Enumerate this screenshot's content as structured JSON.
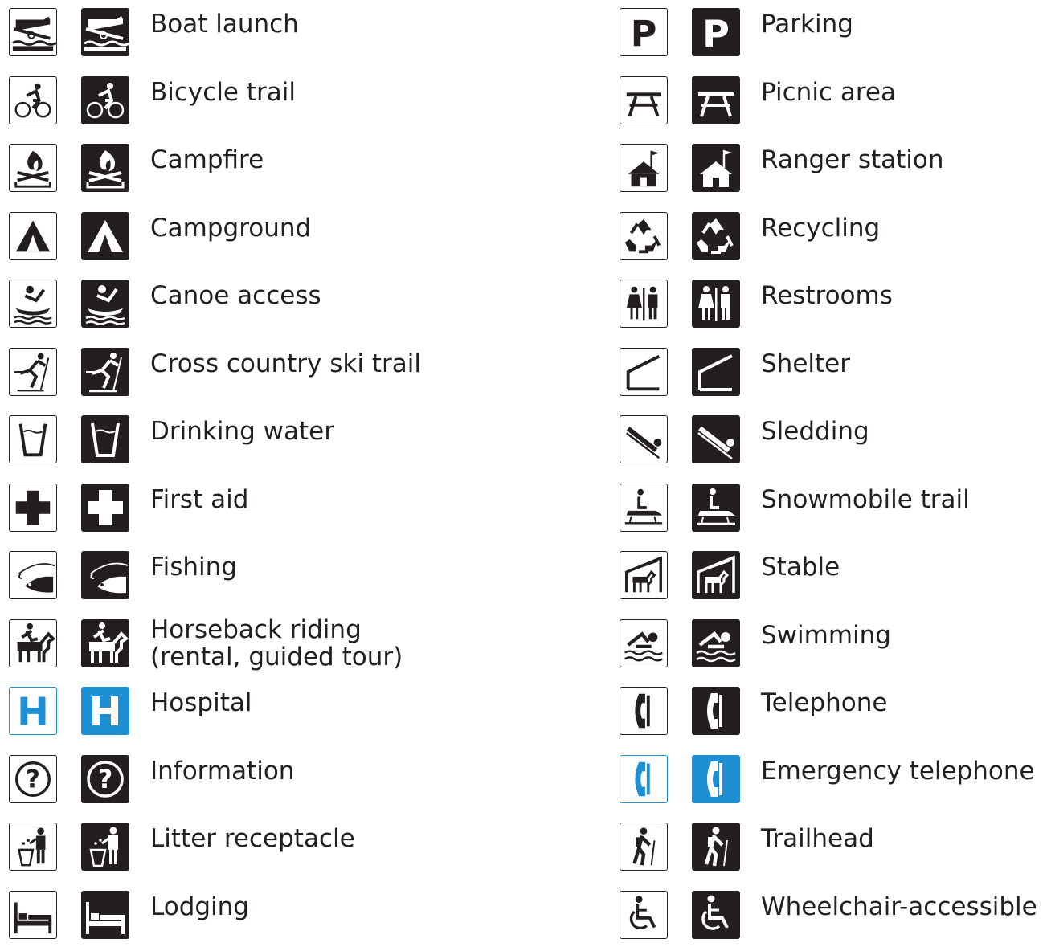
{
  "colors": {
    "ink": "#231f20",
    "paper": "#ffffff",
    "medical_blue": "#1e8fd2"
  },
  "left": [
    {
      "key": "boat",
      "icon": "boat-launch-icon",
      "label": "Boat launch"
    },
    {
      "key": "bicycle",
      "icon": "bicycle-icon",
      "label": "Bicycle trail"
    },
    {
      "key": "campfire",
      "icon": "campfire-icon",
      "label": "Campfire"
    },
    {
      "key": "tent",
      "icon": "tent-icon",
      "label": "Campground"
    },
    {
      "key": "canoe",
      "icon": "canoe-icon",
      "label": "Canoe access"
    },
    {
      "key": "ski",
      "icon": "cross-country-skier-icon",
      "label": "Cross country ski trail"
    },
    {
      "key": "water",
      "icon": "drinking-cup-icon",
      "label": "Drinking water"
    },
    {
      "key": "cross",
      "icon": "first-aid-cross-icon",
      "label": "First aid"
    },
    {
      "key": "fish",
      "icon": "fish-hook-icon",
      "label": "Fishing"
    },
    {
      "key": "horse",
      "icon": "horse-rider-icon",
      "label": "Horseback riding",
      "label2": "(rental, guided tour)"
    },
    {
      "key": "hospital",
      "icon": "hospital-h-icon",
      "label": "Hospital",
      "blue": true
    },
    {
      "key": "info",
      "icon": "question-mark-icon",
      "label": "Information"
    },
    {
      "key": "litter",
      "icon": "litter-bin-icon",
      "label": "Litter receptacle"
    },
    {
      "key": "bed",
      "icon": "bed-icon",
      "label": "Lodging"
    }
  ],
  "right": [
    {
      "key": "parking",
      "icon": "parking-p-icon",
      "label": "Parking"
    },
    {
      "key": "picnic",
      "icon": "picnic-table-icon",
      "label": "Picnic area"
    },
    {
      "key": "ranger",
      "icon": "ranger-house-flag-icon",
      "label": "Ranger station"
    },
    {
      "key": "recycle",
      "icon": "recycling-arrows-icon",
      "label": "Recycling"
    },
    {
      "key": "restroom",
      "icon": "restroom-figures-icon",
      "label": "Restrooms"
    },
    {
      "key": "shelter",
      "icon": "shelter-roof-icon",
      "label": "Shelter"
    },
    {
      "key": "sled",
      "icon": "sledder-icon",
      "label": "Sledding"
    },
    {
      "key": "snowmobile",
      "icon": "snowmobile-icon",
      "label": "Snowmobile trail"
    },
    {
      "key": "stable",
      "icon": "stable-horse-icon",
      "label": "Stable"
    },
    {
      "key": "swim",
      "icon": "swimmer-icon",
      "label": "Swimming"
    },
    {
      "key": "phone",
      "icon": "telephone-handset-icon",
      "label": "Telephone"
    },
    {
      "key": "phone",
      "icon": "emergency-telephone-icon",
      "label": "Emergency telephone",
      "blue": true
    },
    {
      "key": "hiker",
      "icon": "hiker-icon",
      "label": "Trailhead"
    },
    {
      "key": "wheelchair",
      "icon": "wheelchair-icon",
      "label": "Wheelchair-accessible"
    }
  ]
}
